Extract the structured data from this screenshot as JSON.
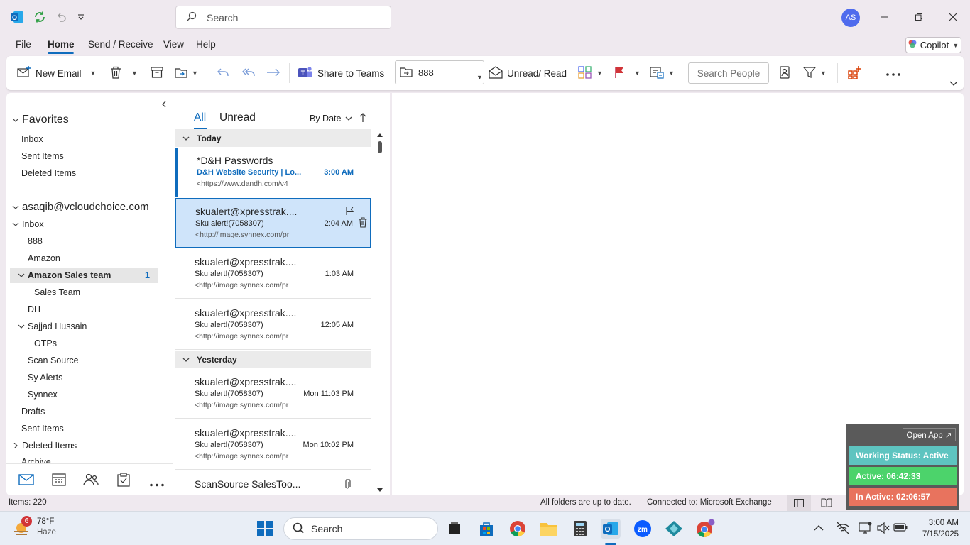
{
  "titlebar": {
    "search_placeholder": "Search",
    "avatar_initials": "AS"
  },
  "menu": {
    "tabs": [
      "File",
      "Home",
      "Send / Receive",
      "View",
      "Help"
    ],
    "active": "Home",
    "copilot_label": "Copilot"
  },
  "ribbon": {
    "new_email": "New Email",
    "share_to_teams": "Share to Teams",
    "move_folder": "888",
    "unread_read": "Unread/ Read",
    "search_people_placeholder": "Search People"
  },
  "folders": {
    "favorites_label": "Favorites",
    "favorites": [
      "Inbox",
      "Sent Items",
      "Deleted Items"
    ],
    "account": "asaqib@vcloudchoice.com",
    "inbox_label": "Inbox",
    "inbox_sub": {
      "f888": "888",
      "amazon": "Amazon",
      "amazon_sales": "Amazon Sales team",
      "amazon_sales_count": "1",
      "sales_team": "Sales Team",
      "dh": "DH",
      "sajjad": "Sajjad Hussain",
      "otps": "OTPs",
      "scan_source": "Scan Source",
      "sy_alerts": "Sy Alerts",
      "synnex": "Synnex"
    },
    "drafts": "Drafts",
    "sent_items": "Sent Items",
    "deleted_items": "Deleted Items",
    "archive": "Archive"
  },
  "message_list": {
    "tab_all": "All",
    "tab_unread": "Unread",
    "sort_label": "By Date",
    "groups": {
      "today": "Today",
      "yesterday": "Yesterday"
    },
    "messages": [
      {
        "from": "*D&H Passwords",
        "subject": "D&H Website Security | Lo...",
        "preview": "<https://www.dandh.com/v4",
        "time": "3:00 AM"
      },
      {
        "from": "skualert@xpresstrak....",
        "subject": "Sku alert!(7058307)",
        "preview": "<http://image.synnex.com/pr",
        "time": "2:04 AM"
      },
      {
        "from": "skualert@xpresstrak....",
        "subject": "Sku alert!(7058307)",
        "preview": "<http://image.synnex.com/pr",
        "time": "1:03 AM"
      },
      {
        "from": "skualert@xpresstrak....",
        "subject": "Sku alert!(7058307)",
        "preview": "<http://image.synnex.com/pr",
        "time": "12:05 AM"
      },
      {
        "from": "skualert@xpresstrak....",
        "subject": "Sku alert!(7058307)",
        "preview": "<http://image.synnex.com/pr",
        "time": "Mon 11:03 PM"
      },
      {
        "from": "skualert@xpresstrak....",
        "subject": "Sku alert!(7058307)",
        "preview": "<http://image.synnex.com/pr",
        "time": "Mon 10:02 PM"
      },
      {
        "from": "ScanSource SalesToo...",
        "subject": "",
        "preview": "",
        "time": ""
      }
    ]
  },
  "statusbar": {
    "items": "Items: 220",
    "sync": "All folders are up to date.",
    "connection": "Connected to: Microsoft Exchange"
  },
  "widget": {
    "open_app": "Open App ↗",
    "working_status": "Working Status: Active",
    "active": "Active: 06:42:33",
    "inactive": "In Active: 02:06:57"
  },
  "taskbar": {
    "weather_badge": "6",
    "temperature": "78°F",
    "condition": "Haze",
    "search": "Search",
    "time": "3:00 AM",
    "date": "7/15/2025"
  },
  "colors": {
    "accent": "#0f6cbd",
    "selected_bg": "#cfe4fa",
    "status_active": "#5ec4c0",
    "timer_active": "#4cd36b",
    "timer_inactive": "#e8735e"
  }
}
